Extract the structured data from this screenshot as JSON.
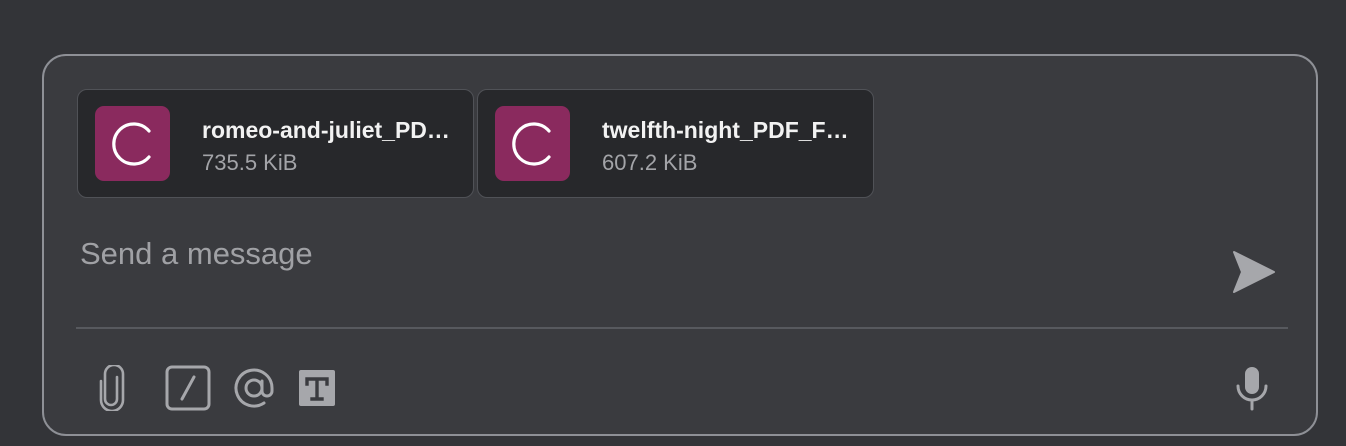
{
  "attachments": [
    {
      "name": "romeo-and-juliet_PDF_FolgerShakespeare.pdf",
      "size": "735.5 KiB",
      "icon": "loading-spinner-icon"
    },
    {
      "name": "twelfth-night_PDF_FolgerShakespeare.pdf",
      "size": "607.2 KiB",
      "icon": "loading-spinner-icon"
    }
  ],
  "composer": {
    "placeholder": "Send a message",
    "value": ""
  },
  "toolbar": {
    "attach": "paperclip-icon",
    "commands": "slash-command-icon",
    "mention": "at-mention-icon",
    "format": "text-format-icon",
    "voice": "microphone-icon",
    "send": "send-icon"
  },
  "colors": {
    "background": "#333438",
    "composer": "#3a3b3f",
    "card": "#27282b",
    "file_icon": "#8a2a5e",
    "icon": "#a6a7ab"
  }
}
